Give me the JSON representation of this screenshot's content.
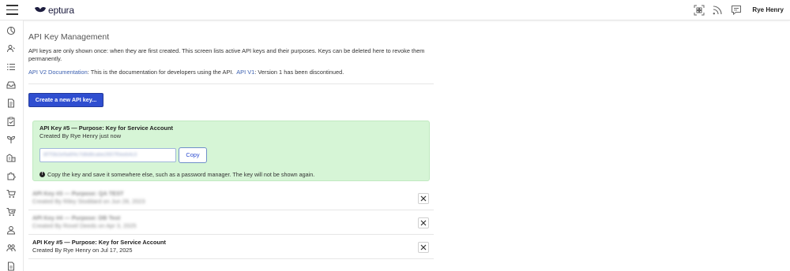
{
  "header": {
    "logo_text": "eptura",
    "user_name": "Rye Henry",
    "icons": [
      "qr-scan-icon",
      "rss-feed-icon",
      "chat-icon"
    ]
  },
  "sidebar": {
    "icons": [
      "dashboard-icon",
      "people-icon",
      "list-icon",
      "inbox-icon",
      "document-icon",
      "clipboard-icon",
      "plant-icon",
      "building-icon",
      "puzzle-icon",
      "cart-icon",
      "cart-move-icon",
      "person-icon",
      "team-icon",
      "file-icon"
    ]
  },
  "main": {
    "title": "API Key Management",
    "intro": "API keys are only shown once: when they are first created. This screen lists active API keys and their purposes. Keys can be deleted here to revoke them permanently.",
    "docs": {
      "v2_link": "API V2 Documentation",
      "v2_text": ": This is the documentation for developers using the API.",
      "v1_link": "API V1",
      "v1_text": ": Version 1 has been discontinued."
    },
    "create_button": "Create a new API key...",
    "new_key": {
      "title": "API Key #5 — Purpose: Key for Service Account",
      "created": "Created By Rye Henry just now",
      "key_value": "8f7f3b2e9a6f4c7d8d8cabe2657f0eeb4c3",
      "copy_label": "Copy",
      "warning": "Copy the key and save it somewhere else, such as a password manager. The key will not be shown again."
    },
    "keys": [
      {
        "title": "API Key #3 — Purpose: QA TEST",
        "created": "Created By Riley Stoddard on Jun 28, 2023",
        "blurred": true
      },
      {
        "title": "API Key #4 — Purpose: DB Test",
        "created": "Created By Rovel Deeds on Apr 3, 2025",
        "blurred": true
      },
      {
        "title": "API Key #5 — Purpose: Key for Service Account",
        "created": "Created By Rye Henry on Jul 17, 2025",
        "blurred": false
      }
    ]
  }
}
